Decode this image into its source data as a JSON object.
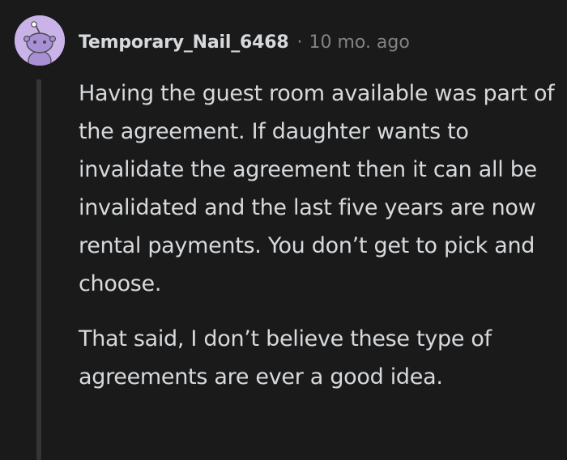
{
  "comment": {
    "username": "Temporary_Nail_6468",
    "separator": "·",
    "timestamp": "10 mo. ago",
    "avatar_icon": "reddit-snoo-avatar-icon",
    "paragraphs": [
      "Having the guest room available was part of the agreement. If daughter wants to invalidate the agreement then it can all be invalidated and the last five years are now rental payments. You don’t get to pick and choose.",
      "That said, I don’t believe these type of agreements are ever a good idea."
    ]
  },
  "colors": {
    "background": "#1a1a1b",
    "text": "#d7dadc",
    "muted": "#818384",
    "avatar_bg": "#c9b3e8",
    "thread_line": "#343536"
  }
}
